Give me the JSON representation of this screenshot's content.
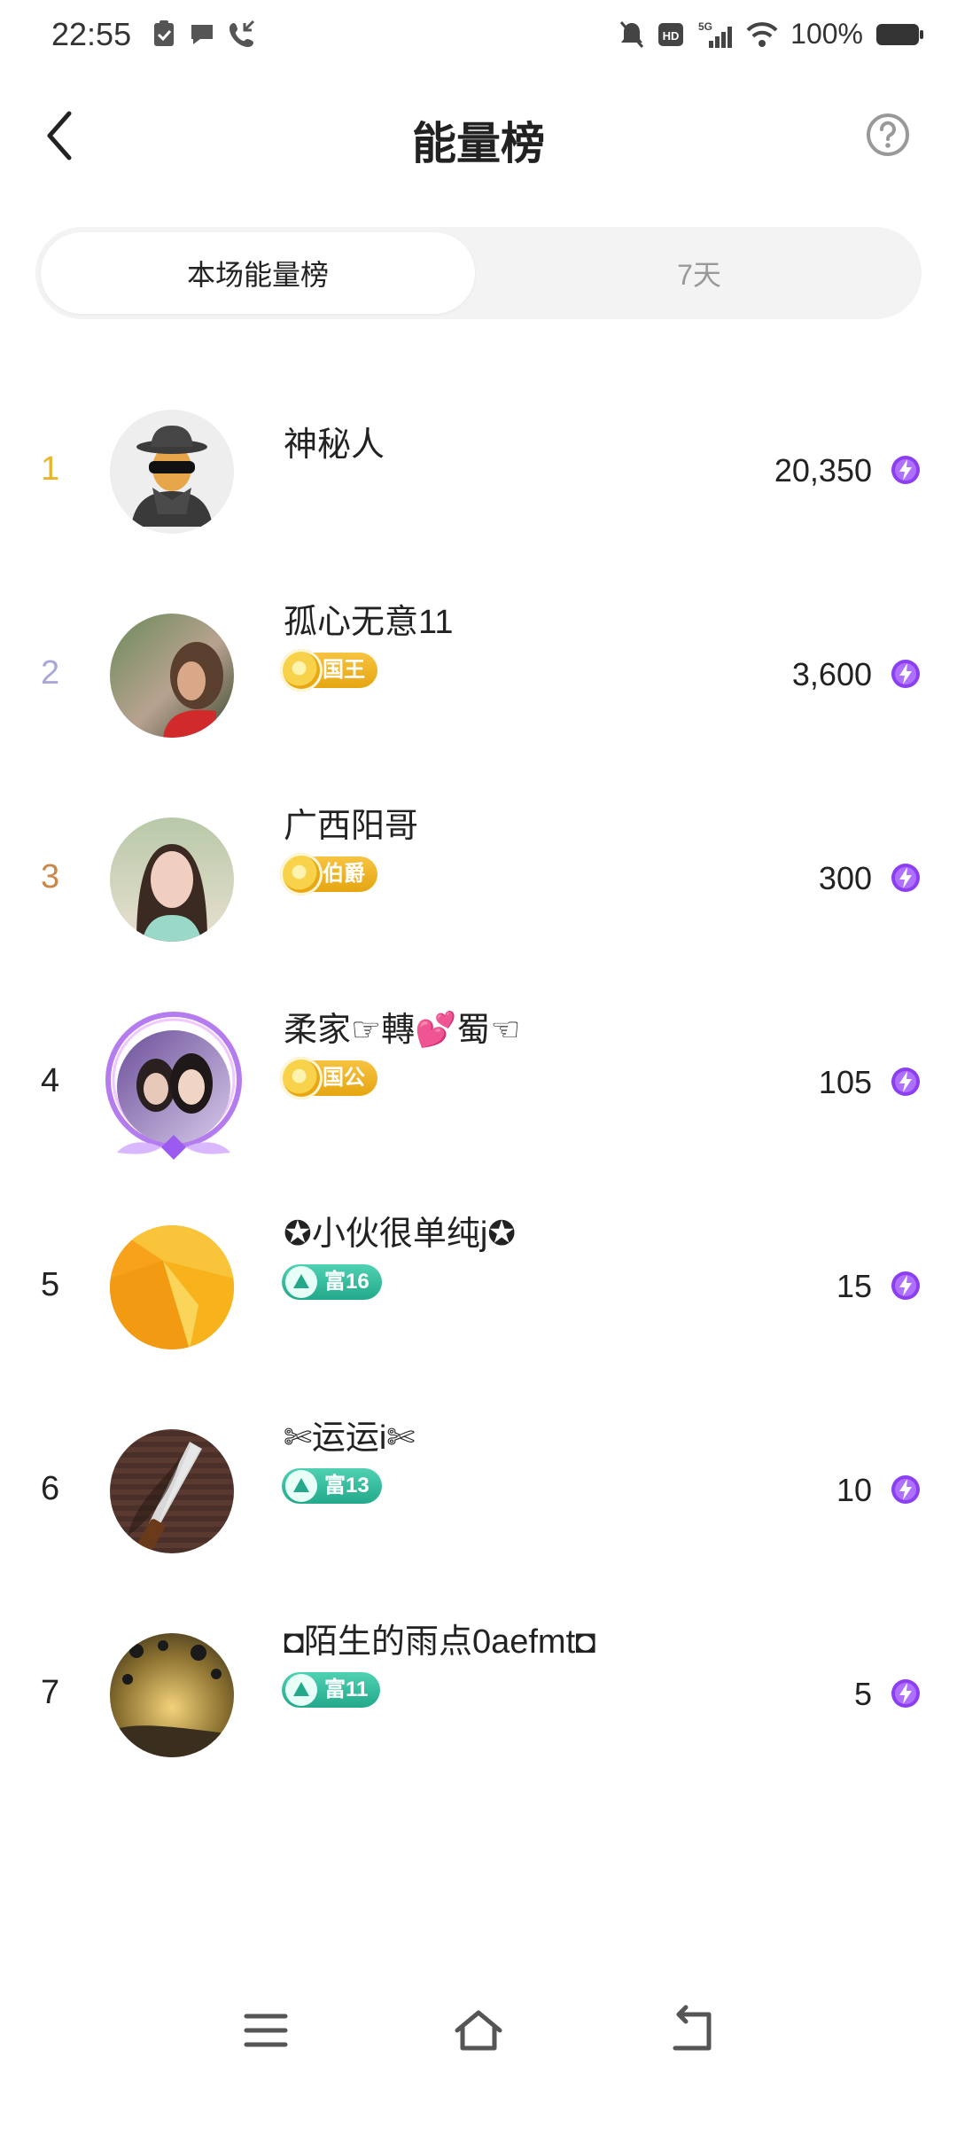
{
  "status_bar": {
    "time": "22:55",
    "battery": "100%"
  },
  "header": {
    "title": "能量榜"
  },
  "tabs": [
    {
      "label": "本场能量榜",
      "active": true
    },
    {
      "label": "7天",
      "active": false
    }
  ],
  "ranking": [
    {
      "rank": "1",
      "name": "神秘人",
      "score": "20,350",
      "badge": "",
      "badge_type": ""
    },
    {
      "rank": "2",
      "name": "孤心无意11",
      "score": "3,600",
      "badge": "国王",
      "badge_type": "gold"
    },
    {
      "rank": "3",
      "name": "广西阳哥",
      "score": "300",
      "badge": "伯爵",
      "badge_type": "gold"
    },
    {
      "rank": "4",
      "name": "柔家☞轉💕蜀☜",
      "score": "105",
      "badge": "国公",
      "badge_type": "gold"
    },
    {
      "rank": "5",
      "name": "✪小伙很单纯j✪",
      "score": "15",
      "badge": "富16",
      "badge_type": "green"
    },
    {
      "rank": "6",
      "name": "✄运运i✄",
      "score": "10",
      "badge": "富13",
      "badge_type": "green"
    },
    {
      "rank": "7",
      "name": "◘陌生的雨点0aefmt◘",
      "score": "5",
      "badge": "富11",
      "badge_type": "green"
    }
  ],
  "colors": {
    "rank1": "#e8b52c",
    "rank2": "#a8a8d8",
    "rank3": "#c8884a",
    "energy": "#8b3ff0"
  }
}
